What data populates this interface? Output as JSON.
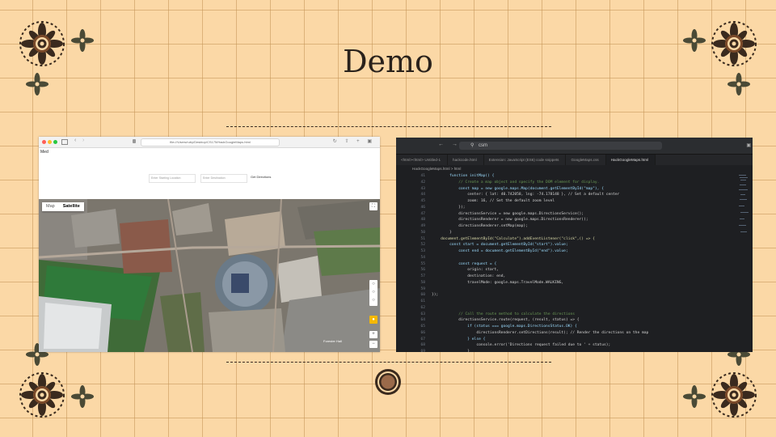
{
  "slide": {
    "title": "Demo"
  },
  "colors": {
    "background": "#fbd8a6",
    "grid": "#c49455",
    "ornament_dark": "#3a2a1e",
    "ornament_accent": "#7a4a2a",
    "editor_bg": "#1e1f22"
  },
  "browser": {
    "url": "file:///Users/ruby/Desktop/CS175/HackGoogleMaps.html",
    "page_text": "Med",
    "start_placeholder": "Enter Starting Location",
    "end_placeholder": "Enter Destination",
    "directions_button": "Get Directions",
    "map_type": [
      "Map",
      "Satellite"
    ],
    "map_type_selected": "Satellite",
    "map_label": "Forester Hall"
  },
  "editor": {
    "search_text": "csm",
    "breadcrumb": "HackGoogleMaps.html > html",
    "tabs": [
      "<html><html> Untitled-1",
      "hackcode.html",
      "Extension: JavaScript (ES6) code snippets",
      "GoogleMaps.css",
      "HackGoogleMaps.html"
    ],
    "active_tab": 4,
    "lines": [
      {
        "n": "41",
        "t": "        function initMap() {"
      },
      {
        "n": "42",
        "t": "            // Create a map object and specify the DOM element for display."
      },
      {
        "n": "43",
        "t": "            const map = new google.maps.Map(document.getElementById(\"map\"), {"
      },
      {
        "n": "44",
        "t": "                center: { lat: 40.742058, lng: -74.178148 }, // Set a default center"
      },
      {
        "n": "45",
        "t": "                zoom: 16, // Set the default zoom level"
      },
      {
        "n": "46",
        "t": "            });"
      },
      {
        "n": "47",
        "t": "            directionsService = new google.maps.DirectionsService();"
      },
      {
        "n": "48",
        "t": "            directionsRenderer = new google.maps.DirectionsRenderer();"
      },
      {
        "n": "49",
        "t": "            directionsRenderer.setMap(map);"
      },
      {
        "n": "50",
        "t": "        }"
      },
      {
        "n": "51",
        "t": "    document.getElementById(\"Calculate\").addEventListener(\"click\",() => {"
      },
      {
        "n": "52",
        "t": "        const start = document.getElementById(\"start\").value;"
      },
      {
        "n": "53",
        "t": "            const end = document.getElementById(\"end\").value;"
      },
      {
        "n": "54",
        "t": ""
      },
      {
        "n": "55",
        "t": "            const request = {"
      },
      {
        "n": "56",
        "t": "                origin: start,"
      },
      {
        "n": "57",
        "t": "                destination: end,"
      },
      {
        "n": "58",
        "t": "                travelMode: google.maps.TravelMode.WALKING,"
      },
      {
        "n": "59",
        "t": ""
      },
      {
        "n": "60",
        "t": "});"
      },
      {
        "n": "61",
        "t": ""
      },
      {
        "n": "62",
        "t": ""
      },
      {
        "n": "63",
        "t": "            // Call the route method to calculate the directions"
      },
      {
        "n": "64",
        "t": "            directionsService.route(request, (result, status) => {"
      },
      {
        "n": "65",
        "t": "                if (status === google.maps.DirectionsStatus.OK) {"
      },
      {
        "n": "66",
        "t": "                    directionsRenderer.setDirections(result); // Render the directions on the map"
      },
      {
        "n": "67",
        "t": "                } else {"
      },
      {
        "n": "68",
        "t": "                    console.error('Directions request failed due to ' + status);"
      },
      {
        "n": "69",
        "t": "                }"
      },
      {
        "n": "70",
        "t": "            });"
      }
    ]
  }
}
